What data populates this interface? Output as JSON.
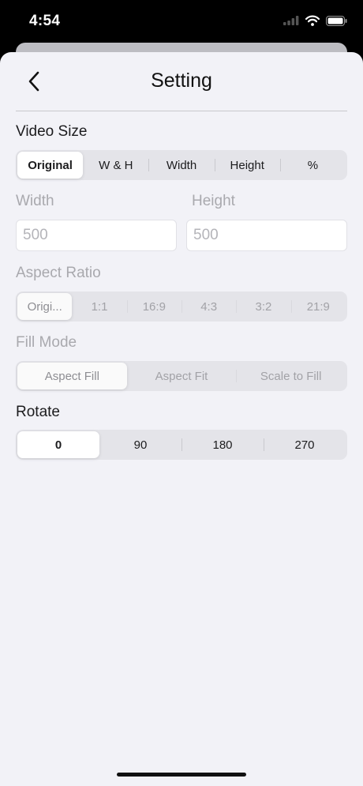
{
  "status_bar": {
    "time": "4:54",
    "icons": [
      "signal-icon",
      "wifi-icon",
      "battery-icon"
    ]
  },
  "nav": {
    "title": "Setting",
    "back_icon": "chevron-left-icon"
  },
  "video_size": {
    "label": "Video Size",
    "options": [
      "Original",
      "W & H",
      "Width",
      "Height",
      "%"
    ],
    "selected": "Original"
  },
  "dimensions": {
    "width_label": "Width",
    "width_placeholder": "500",
    "height_label": "Height",
    "height_placeholder": "500"
  },
  "aspect_ratio": {
    "label": "Aspect Ratio",
    "options": [
      "Origi...",
      "1:1",
      "16:9",
      "4:3",
      "3:2",
      "21:9"
    ],
    "selected": "Origi..."
  },
  "fill_mode": {
    "label": "Fill Mode",
    "options": [
      "Aspect Fill",
      "Aspect Fit",
      "Scale to Fill"
    ],
    "selected": "Aspect Fill"
  },
  "rotate": {
    "label": "Rotate",
    "options": [
      "0",
      "90",
      "180",
      "270"
    ],
    "selected": "0"
  },
  "colors": {
    "background": "#f2f2f7",
    "segment_bg": "#e4e4e9",
    "disabled_text": "#a9a9ae"
  }
}
